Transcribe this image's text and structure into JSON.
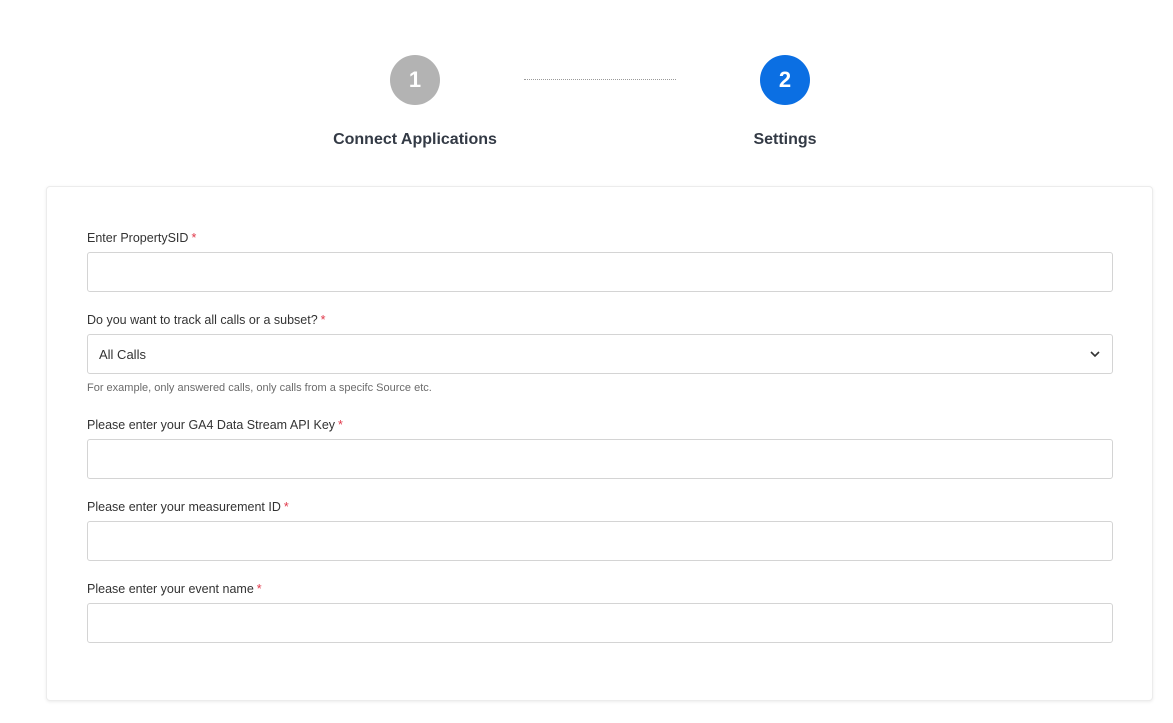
{
  "stepper": {
    "steps": [
      {
        "number": "1",
        "label": "Connect Applications",
        "state": "inactive"
      },
      {
        "number": "2",
        "label": "Settings",
        "state": "active"
      }
    ]
  },
  "colors": {
    "active_step": "#0b6fe3",
    "inactive_step": "#b3b3b3",
    "required_marker": "#e0384a"
  },
  "form": {
    "required_marker": "*",
    "property_sid": {
      "label": "Enter PropertySID",
      "value": ""
    },
    "track_calls": {
      "label": "Do you want to track all calls or a subset?",
      "selected": "All Calls",
      "help": "For example, only answered calls, only calls from a specifc Source etc."
    },
    "api_key": {
      "label": "Please enter your GA4 Data Stream API Key",
      "value": ""
    },
    "measurement_id": {
      "label": "Please enter your measurement ID",
      "value": ""
    },
    "event_name": {
      "label": "Please enter your event name",
      "value": ""
    }
  }
}
